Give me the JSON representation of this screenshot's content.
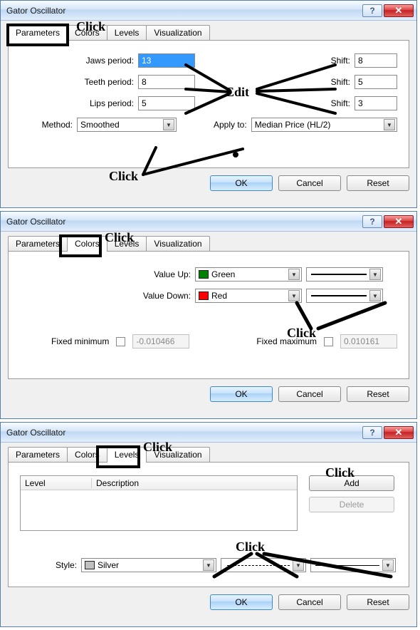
{
  "dialogs": {
    "title": "Gator Oscillator",
    "tabs": {
      "parameters": "Parameters",
      "colors": "Colors",
      "levels": "Levels",
      "visualization": "Visualization"
    },
    "buttons": {
      "ok": "OK",
      "cancel": "Cancel",
      "reset": "Reset",
      "add": "Add",
      "delete": "Delete",
      "help": "?",
      "close": "✕"
    }
  },
  "parameters": {
    "jaws_label": "Jaws period:",
    "jaws_value": "13",
    "jaws_shift_label": "Shift:",
    "jaws_shift_value": "8",
    "teeth_label": "Teeth period:",
    "teeth_value": "8",
    "teeth_shift_label": "Shift:",
    "teeth_shift_value": "5",
    "lips_label": "Lips period:",
    "lips_value": "5",
    "lips_shift_label": "Shift:",
    "lips_shift_value": "3",
    "method_label": "Method:",
    "method_value": "Smoothed",
    "apply_label": "Apply to:",
    "apply_value": "Median Price (HL/2)"
  },
  "colors": {
    "value_up_label": "Value Up:",
    "value_up_color_name": "Green",
    "value_up_color": "#008000",
    "value_down_label": "Value Down:",
    "value_down_color_name": "Red",
    "value_down_color": "#ff0000",
    "fixed_min_label": "Fixed minimum",
    "fixed_min_value": "-0.010466",
    "fixed_max_label": "Fixed maximum",
    "fixed_max_value": "0.010161"
  },
  "levels": {
    "col_level": "Level",
    "col_desc": "Description",
    "style_label": "Style:",
    "style_color_name": "Silver",
    "style_color": "#c0c0c0"
  },
  "annotations": {
    "click": "Click",
    "edit": "Edit"
  }
}
